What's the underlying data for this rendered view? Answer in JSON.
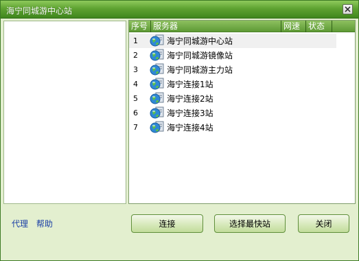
{
  "window": {
    "title": "海宁同城游中心站"
  },
  "table": {
    "columns": [
      "序号",
      "服务器",
      "网速",
      "状态"
    ],
    "rows": [
      {
        "seq": "1",
        "name": "海宁同城游中心站"
      },
      {
        "seq": "2",
        "name": "海宁同城游镜像站"
      },
      {
        "seq": "3",
        "name": "海宁同城游主力站"
      },
      {
        "seq": "4",
        "name": "海宁连接1站"
      },
      {
        "seq": "5",
        "name": "海宁连接2站"
      },
      {
        "seq": "6",
        "name": "海宁连接3站"
      },
      {
        "seq": "7",
        "name": "海宁连接4站"
      }
    ],
    "selected_row": 1
  },
  "links": {
    "proxy": "代理",
    "help": "帮助"
  },
  "buttons": {
    "connect": "连接",
    "fastest": "选择最快站",
    "close": "关闭"
  },
  "colors": {
    "title_green": "#5fa332",
    "link_blue": "#1a3fa6",
    "button_border": "#5f8f3a"
  }
}
